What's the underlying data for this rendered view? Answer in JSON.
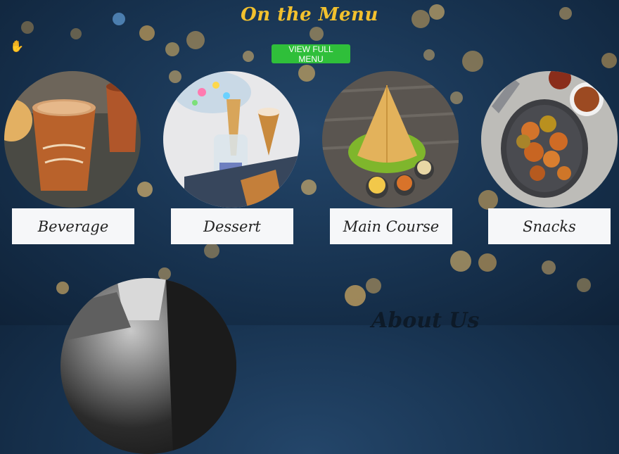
{
  "section": {
    "title": "On the Menu",
    "button_label": "VIEW FULL MENU"
  },
  "categories": [
    {
      "label": "Beverage",
      "image": "tea-cups-image"
    },
    {
      "label": "Dessert",
      "image": "ice-cream-cones-image"
    },
    {
      "label": "Main Course",
      "image": "dosa-plate-image"
    },
    {
      "label": "Snacks",
      "image": "pakora-plate-image"
    }
  ],
  "about": {
    "title": "About Us"
  },
  "colors": {
    "title": "#f2c12e",
    "button": "#2fbf3a",
    "background": "#17324f",
    "card": "#f6f7f9"
  },
  "icons": {
    "cursor": "hand-cursor-icon"
  }
}
